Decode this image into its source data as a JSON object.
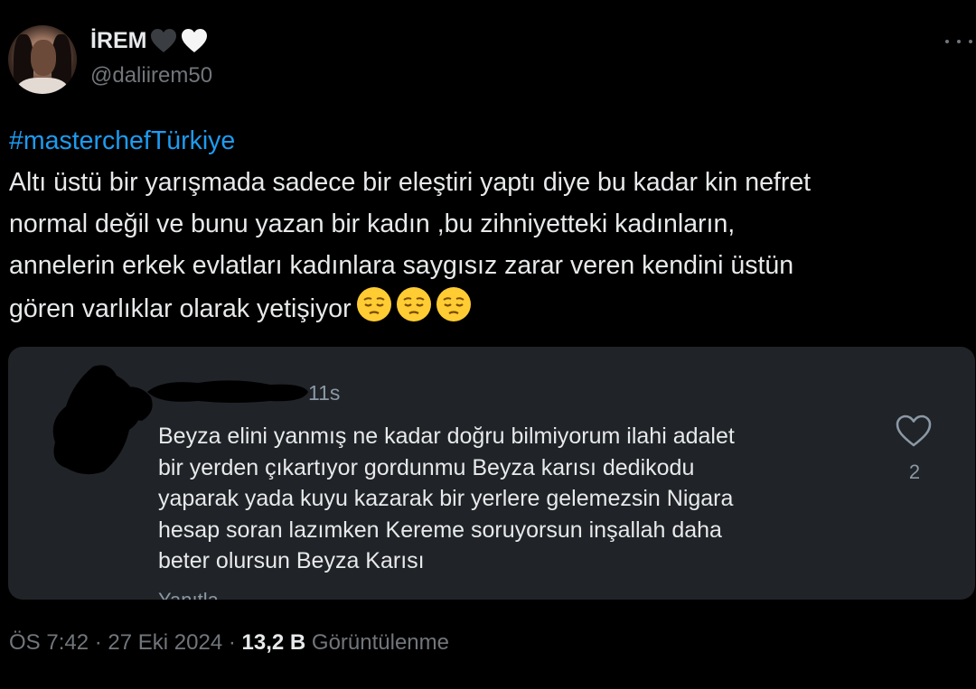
{
  "author": {
    "display_name": "İREM",
    "handle": "@daliirem50",
    "name_emojis": [
      "black-heart",
      "white-heart"
    ]
  },
  "tweet": {
    "hashtag": "#masterchefTürkiye",
    "lines": [
      "Altı üstü bir yarışmada sadece bir eleştiri yaptı diye bu kadar kin nefret",
      "normal değil ve bunu yazan bir kadın ,bu zihniyetteki kadınların,",
      "annelerin erkek evlatları kadınlara saygısız zarar veren kendini üstün",
      "gören varlıklar olarak yetişiyor"
    ],
    "emojis": [
      "pensive-face",
      "pensive-face",
      "pensive-face"
    ]
  },
  "quoted_reply": {
    "time": "11s",
    "lines": [
      "Beyza elini yanmış ne kadar doğru bilmiyorum ilahi adalet",
      "bir yerden çıkartıyor gordunmu Beyza karısı dedikodu",
      "yaparak yada kuyu kazarak bir yerlere gelemezsin Nigara",
      "hesap soran lazımken Kereme soruyorsun inşallah daha",
      "beter olursun Beyza Karısı"
    ],
    "cut_off_text": "Yanıtla",
    "like_count": "2",
    "icons": [
      "heart-outline-icon"
    ]
  },
  "meta": {
    "time": "ÖS 7:42",
    "separator": "·",
    "date": "27 Eki 2024",
    "views_count": "13,2 B",
    "views_label": "Görüntülenme"
  },
  "colors": {
    "background": "#000000",
    "text": "#e7e9ea",
    "secondary": "#71767b",
    "link": "#1d9bf0",
    "card": "#202327"
  }
}
